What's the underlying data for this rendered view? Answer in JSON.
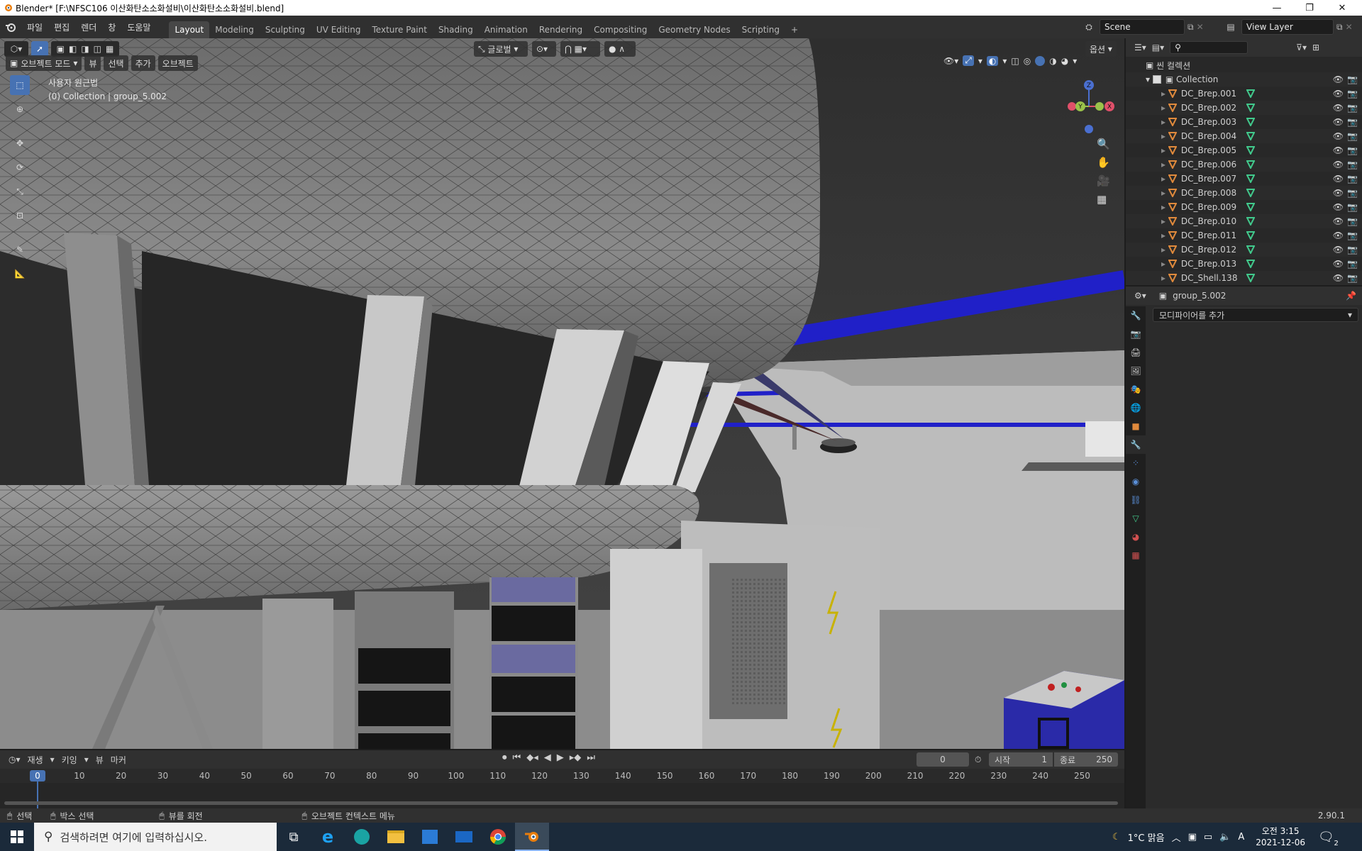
{
  "window": {
    "title": "Blender* [F:\\NFSC106 이산화탄소소화설비\\이산화탄소소화설비.blend]"
  },
  "menus": [
    "파일",
    "편집",
    "렌더",
    "창",
    "도움말"
  ],
  "workspaces": [
    "Layout",
    "Modeling",
    "Sculpting",
    "UV Editing",
    "Texture Paint",
    "Shading",
    "Animation",
    "Rendering",
    "Compositing",
    "Geometry Nodes",
    "Scripting"
  ],
  "active_workspace": "Layout",
  "scene": {
    "name": "Scene",
    "view_layer": "View Layer"
  },
  "viewport": {
    "orientation": "글로벌",
    "options_label": "옵션",
    "mode": "오브젝트 모드",
    "header_menus": [
      "뷰",
      "선택",
      "추가",
      "오브젝트"
    ],
    "overlay_line1": "사용자 원근법",
    "overlay_line2": "(0) Collection | group_5.002",
    "gizmo_axes": {
      "z": "Z",
      "x": "X",
      "y": "Y"
    }
  },
  "outliner": {
    "root": "씬 컬렉션",
    "collection": "Collection",
    "items": [
      "DC_Brep.001",
      "DC_Brep.002",
      "DC_Brep.003",
      "DC_Brep.004",
      "DC_Brep.005",
      "DC_Brep.006",
      "DC_Brep.007",
      "DC_Brep.008",
      "DC_Brep.009",
      "DC_Brep.010",
      "DC_Brep.011",
      "DC_Brep.012",
      "DC_Brep.013",
      "DC_Shell.138"
    ]
  },
  "properties": {
    "object_name": "group_5.002",
    "add_modifier": "모디파이어를 추가"
  },
  "timeline": {
    "menus": [
      "재생",
      "키잉",
      "뷰",
      "마커"
    ],
    "current_frame": "0",
    "start_label": "시작",
    "start": "1",
    "end_label": "종료",
    "end": "250",
    "ruler": [
      "0",
      "10",
      "20",
      "30",
      "40",
      "50",
      "60",
      "70",
      "80",
      "90",
      "100",
      "110",
      "120",
      "130",
      "140",
      "150",
      "160",
      "170",
      "180",
      "190",
      "200",
      "210",
      "220",
      "230",
      "240",
      "250"
    ],
    "ruler_min": 0,
    "ruler_max": 250
  },
  "status": {
    "select": "선택",
    "box_select": "박스 선택",
    "rotate": "뷰를 회전",
    "context": "오브젝트 컨텍스트 메뉴",
    "version": "2.90.1"
  },
  "taskbar": {
    "search_placeholder": "검색하려면 여기에 입력하십시오.",
    "weather": "1°C 맑음",
    "ime": "A",
    "time": "오전 3:15",
    "date": "2021-12-06",
    "notifications": "2"
  },
  "colors": {
    "accent": "#4772b3",
    "header": "#303030",
    "panel": "#282828",
    "pipe_blue": "#2020c8",
    "mesh_icon": "#e08a3c",
    "data_icon": "#41c98c",
    "cabinet_blue": "#2a2aa8"
  }
}
